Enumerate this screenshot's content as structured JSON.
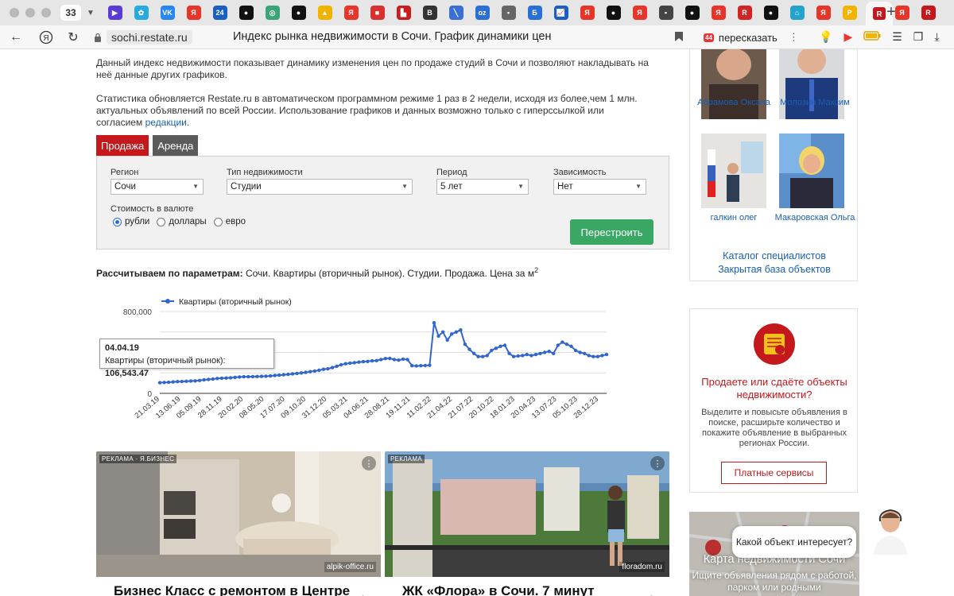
{
  "browser": {
    "tab_count": "33",
    "favicons": [
      {
        "name": "play-icon",
        "label": "▶",
        "color": "#5a3bd6"
      },
      {
        "name": "puzzle-icon",
        "label": "✿",
        "color": "#28a9e0"
      },
      {
        "name": "vk-icon",
        "label": "VK",
        "color": "#2787f5"
      },
      {
        "name": "yandex-icon",
        "label": "Я",
        "color": "#e8352a"
      },
      {
        "name": "news24-icon",
        "label": "24",
        "color": "#1b5fbf"
      },
      {
        "name": "black-dot-icon",
        "label": "●",
        "color": "#111"
      },
      {
        "name": "chatgpt-icon",
        "label": "◎",
        "color": "#3aa678"
      },
      {
        "name": "black-dot-icon",
        "label": "●",
        "color": "#111"
      },
      {
        "name": "warning-icon",
        "label": "▲",
        "color": "#f0b400"
      },
      {
        "name": "yandex-icon",
        "label": "Я",
        "color": "#e8352a"
      },
      {
        "name": "red-square-icon",
        "label": "■",
        "color": "#d93030"
      },
      {
        "name": "red-block-icon",
        "label": "▙",
        "color": "#c91c1c"
      },
      {
        "name": "b-icon",
        "label": "B",
        "color": "#333"
      },
      {
        "name": "slash-icon",
        "label": "╲",
        "color": "#3a6fd6"
      },
      {
        "name": "ozon-icon",
        "label": "oz",
        "color": "#2a6fd6"
      },
      {
        "name": "site-icon",
        "label": "▪",
        "color": "#666"
      },
      {
        "name": "b-blue-icon",
        "label": "Б",
        "color": "#2a6fd6"
      },
      {
        "name": "chart-icon",
        "label": "📈",
        "color": "#1c5fc4"
      },
      {
        "name": "yandex-icon",
        "label": "Я",
        "color": "#e8352a"
      },
      {
        "name": "black-dot-icon",
        "label": "●",
        "color": "#111"
      },
      {
        "name": "yandex-icon",
        "label": "Я",
        "color": "#e8352a"
      },
      {
        "name": "site-icon",
        "label": "▪",
        "color": "#444"
      },
      {
        "name": "black-dot-icon",
        "label": "●",
        "color": "#111"
      },
      {
        "name": "yandex-icon",
        "label": "Я",
        "color": "#e8352a"
      },
      {
        "name": "r-icon",
        "label": "R",
        "color": "#d12424"
      },
      {
        "name": "black-dot-icon",
        "label": "●",
        "color": "#111"
      },
      {
        "name": "home-icon",
        "label": "⌂",
        "color": "#25a3c9"
      },
      {
        "name": "yandex-icon",
        "label": "Я",
        "color": "#e8352a"
      },
      {
        "name": "p-icon",
        "label": "P",
        "color": "#f2b400"
      },
      {
        "name": "red-circle-icon",
        "label": "●",
        "color": "#e33"
      },
      {
        "name": "yandex-icon",
        "label": "Я",
        "color": "#e8352a"
      },
      {
        "name": "restate-icon",
        "label": "R",
        "color": "#c5181c"
      }
    ],
    "url_host": "sochi.restate.ru",
    "page_title": "Индекс рынка недвижимости в Сочи. График динамики цен",
    "retell_label": "пересказать",
    "retell_badge": "44"
  },
  "page": {
    "desc1": "Данный индекс недвижимости показывает динамику изменения цен по продаже студий в Сочи и позволяют накладывать на неё данные других графиков.",
    "desc2": "Статистика обновляется Restate.ru в автоматическом программном режиме 1 раз в 2 недели, исходя из более,чем 1 млн. актуальных объявлений по всей России. Использование графиков и данных возможно только с гиперссылкой или согласием ",
    "desc2_link": "редакции",
    "desc2_end": ".",
    "tabs": {
      "sale": "Продажа",
      "rent": "Аренда"
    },
    "filters": {
      "region_label": "Регион",
      "region_value": "Сочи",
      "type_label": "Тип недвижимости",
      "type_value": "Студии",
      "period_label": "Период",
      "period_value": "5 лет",
      "dep_label": "Зависимость",
      "dep_value": "Нет",
      "currency_label": "Стоимость в валюте",
      "currencies": [
        "рубли",
        "доллары",
        "евро"
      ],
      "rebuild_button": "Перестроить"
    },
    "params_bold": "Рассчитываем по параметрам:",
    "params_text": " Сочи. Квартиры (вторичный рынок). Студии. Продажа. Цена за м",
    "params_sup": "2",
    "tooltip": {
      "date": "04.04.19",
      "label": "Квартиры (вторичный рынок): ",
      "value": "106,543.47"
    },
    "ads": [
      {
        "label": "РЕКЛАМА · Я.БИЗНЕС",
        "source": "alpik-office.ru",
        "title": "Бизнес Класс с ремонтом в Центре"
      },
      {
        "label": "РЕКЛАМА",
        "source": "floradom.ru",
        "title": "ЖК «Флора» в Сочи. 7 минут"
      }
    ]
  },
  "sidebar": {
    "specialists": [
      {
        "name": "Абрамова Оксана"
      },
      {
        "name": "Молозин Максим"
      },
      {
        "name": "галкин олег"
      },
      {
        "name": "Макаровская Ольга"
      }
    ],
    "catalog_link": "Каталог специалистов",
    "closed_base_link": "Закрытая база объектов",
    "sell_title": "Продаете или сдаёте объекты недвижимости?",
    "sell_text": "Выделите и повысьте объявления в поиске, расширьте количество и покажите объявление в выбранных регионах России.",
    "paid_button": "Платные сервисы",
    "map_title": "Карта недвижимости Сочи",
    "map_sub": "Ищите объявления рядом с работой, парком или родными",
    "chat_text": "Какой объект интересует?"
  },
  "chart_data": {
    "type": "line",
    "legend": "Квартиры (вторичный рынок)",
    "legend_position": "top",
    "color": "#3366cc",
    "ylim": [
      0,
      800000
    ],
    "ytick_labels": [
      "0",
      "800,000"
    ],
    "ytick_values": [
      0,
      800000
    ],
    "grid": true,
    "x_tick_labels": [
      "21.03.19",
      "13.06.19",
      "05.09.19",
      "28.11.19",
      "20.02.20",
      "08.05.20",
      "17.07.20",
      "09.10.20",
      "31.12.20",
      "05.03.21",
      "04.06.21",
      "28.08.21",
      "19.11.21",
      "11.02.22",
      "21.04.22",
      "21.07.22",
      "20.10.22",
      "18.01.23",
      "20.04.23",
      "13.07.23",
      "05.10.23",
      "28.12.23"
    ],
    "values": [
      104000,
      106543,
      108000,
      112000,
      115000,
      116000,
      118000,
      120000,
      122000,
      126000,
      132000,
      136000,
      140000,
      145000,
      148000,
      150000,
      152000,
      156000,
      160000,
      162000,
      162000,
      164000,
      165000,
      166000,
      168000,
      170000,
      175000,
      178000,
      182000,
      186000,
      190000,
      195000,
      200000,
      205000,
      212000,
      218000,
      225000,
      235000,
      240000,
      252000,
      265000,
      280000,
      290000,
      295000,
      300000,
      305000,
      310000,
      312000,
      318000,
      320000,
      330000,
      340000,
      342000,
      330000,
      325000,
      335000,
      330000,
      270000,
      268000,
      270000,
      272000,
      275000,
      690000,
      560000,
      600000,
      520000,
      580000,
      600000,
      620000,
      480000,
      430000,
      390000,
      360000,
      360000,
      370000,
      420000,
      440000,
      460000,
      470000,
      390000,
      360000,
      365000,
      370000,
      380000,
      370000,
      380000,
      390000,
      400000,
      410000,
      390000,
      470000,
      500000,
      480000,
      460000,
      420000,
      400000,
      390000,
      370000,
      360000,
      360000,
      370000,
      380000
    ]
  }
}
